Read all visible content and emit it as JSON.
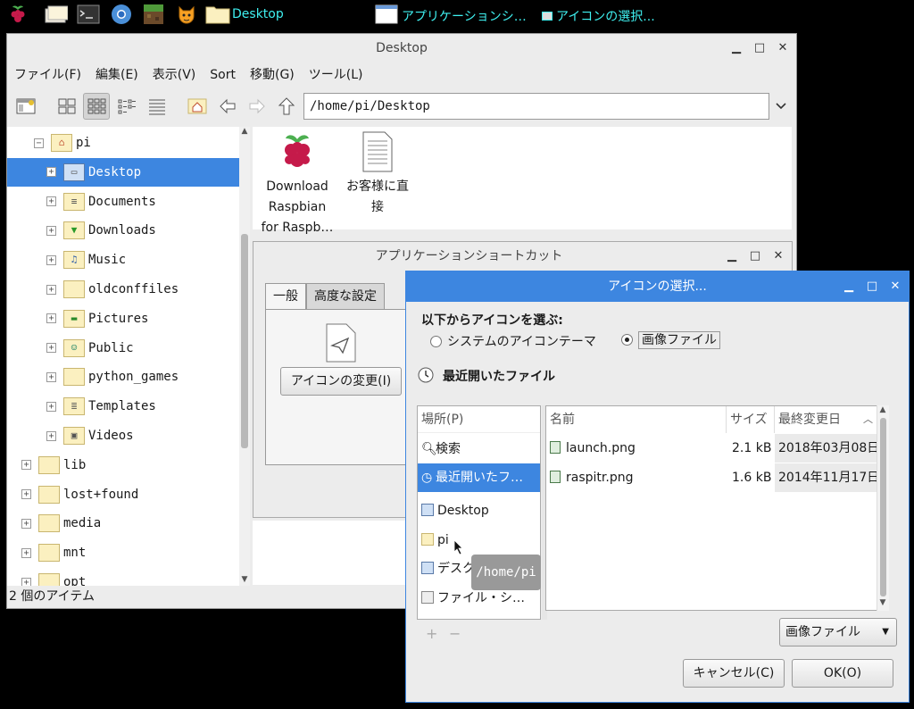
{
  "taskbar": {
    "folder_label": "Desktop",
    "task1": "アプリケーションシ…",
    "task2": "アイコンの選択..."
  },
  "filemanager": {
    "title": "Desktop",
    "menu": [
      "ファイル(F)",
      "編集(E)",
      "表示(V)",
      "Sort",
      "移動(G)",
      "ツール(L)"
    ],
    "address": "/home/pi/Desktop",
    "tree": [
      {
        "label": "pi",
        "indent": 1,
        "exp": "−",
        "icon": "home"
      },
      {
        "label": "Desktop",
        "indent": 2,
        "exp": "+",
        "icon": "desktop",
        "selected": true
      },
      {
        "label": "Documents",
        "indent": 2,
        "exp": "+",
        "icon": "documents"
      },
      {
        "label": "Downloads",
        "indent": 2,
        "exp": "+",
        "icon": "downloads"
      },
      {
        "label": "Music",
        "indent": 2,
        "exp": "+",
        "icon": "music"
      },
      {
        "label": "oldconffiles",
        "indent": 2,
        "exp": "+",
        "icon": "folder"
      },
      {
        "label": "Pictures",
        "indent": 2,
        "exp": "+",
        "icon": "pictures"
      },
      {
        "label": "Public",
        "indent": 2,
        "exp": "+",
        "icon": "public"
      },
      {
        "label": "python_games",
        "indent": 2,
        "exp": "+",
        "icon": "folder"
      },
      {
        "label": "Templates",
        "indent": 2,
        "exp": "+",
        "icon": "templates"
      },
      {
        "label": "Videos",
        "indent": 2,
        "exp": "+",
        "icon": "videos"
      },
      {
        "label": "lib",
        "indent": 0,
        "exp": "+",
        "icon": "folder"
      },
      {
        "label": "lost+found",
        "indent": 0,
        "exp": "+",
        "icon": "folder"
      },
      {
        "label": "media",
        "indent": 0,
        "exp": "+",
        "icon": "folder"
      },
      {
        "label": "mnt",
        "indent": 0,
        "exp": "+",
        "icon": "folder"
      },
      {
        "label": "opt",
        "indent": 0,
        "exp": "+",
        "icon": "folder"
      }
    ],
    "file1_lines": [
      "Download",
      "Raspbian",
      "for Raspb…"
    ],
    "file2_lines": [
      "お客様に直",
      "接"
    ],
    "status": "2 個のアイテム"
  },
  "shortcut_dialog": {
    "title": "アプリケーションショートカット",
    "tab_general": "一般",
    "tab_advanced": "高度な設定",
    "change_icon_button": "アイコンの変更(I)"
  },
  "icon_dialog": {
    "title": "アイコンの選択...",
    "choose_label": "以下からアイコンを選ぶ:",
    "radio_theme": "システムのアイコンテーマ",
    "radio_image": "画像ファイル",
    "recent_heading": "最近開いたファイル",
    "places_header": "場所(P)",
    "places": [
      "検索",
      "最近開いたフ…",
      "Desktop",
      "pi",
      "デスク",
      "ファイル・シ…"
    ],
    "col_name": "名前",
    "col_size": "サイズ",
    "col_modified": "最終変更日",
    "files": [
      {
        "name": "launch.png",
        "size": "2.1 kB",
        "date": "2018年03月08日"
      },
      {
        "name": "raspitr.png",
        "size": "1.6 kB",
        "date": "2014年11月17日"
      }
    ],
    "filter_value": "画像ファイル",
    "cancel_button": "キャンセル(C)",
    "ok_button": "OK(O)",
    "tooltip": "/home/pi"
  }
}
